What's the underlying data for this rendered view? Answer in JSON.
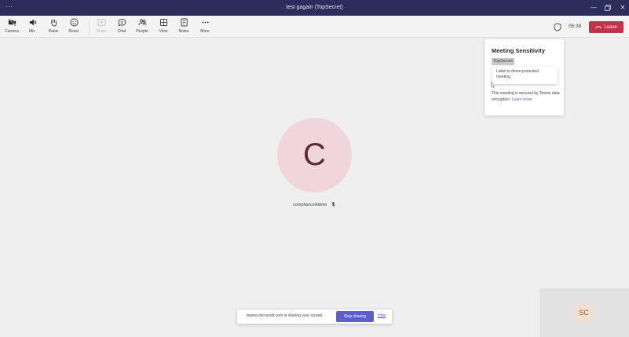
{
  "titlebar": {
    "title": "test gagain (TopSecret)"
  },
  "toolbar": {
    "items": [
      {
        "label": "Camera",
        "icon": "video-off-icon"
      },
      {
        "label": "Mic",
        "icon": "mic-off-icon"
      },
      {
        "label": "Raise",
        "icon": "raise-hand-icon"
      },
      {
        "label": "React",
        "icon": "smile-icon"
      },
      {
        "label": "Share",
        "icon": "share-icon",
        "disabled": true
      },
      {
        "label": "Chat",
        "icon": "chat-icon"
      },
      {
        "label": "People",
        "icon": "people-icon"
      },
      {
        "label": "View",
        "icon": "grid-icon"
      },
      {
        "label": "Notes",
        "icon": "notes-icon"
      },
      {
        "label": "More",
        "icon": "more-icon"
      }
    ],
    "timer": "06:38",
    "leave_label": "Leave"
  },
  "sensitivity": {
    "title": "Meeting Sensitivity",
    "tag": "TopSecret",
    "tooltip": "Label to demo protected meeting",
    "description": "This meeting is secured by Teams data encryption.",
    "link": "Learn more"
  },
  "participant": {
    "initial": "C",
    "name": "complianceAdmin"
  },
  "sharebar": {
    "message": "teams.microsoft.com is sharing your screen.",
    "stop_label": "Stop sharing",
    "hide_label": "Hide"
  },
  "self": {
    "initials": "SC"
  },
  "colors": {
    "titlebar": "#2b2d5a",
    "leave": "#c4314b",
    "accent": "#5b5fc7",
    "avatar_bg": "#f0d6dc"
  }
}
